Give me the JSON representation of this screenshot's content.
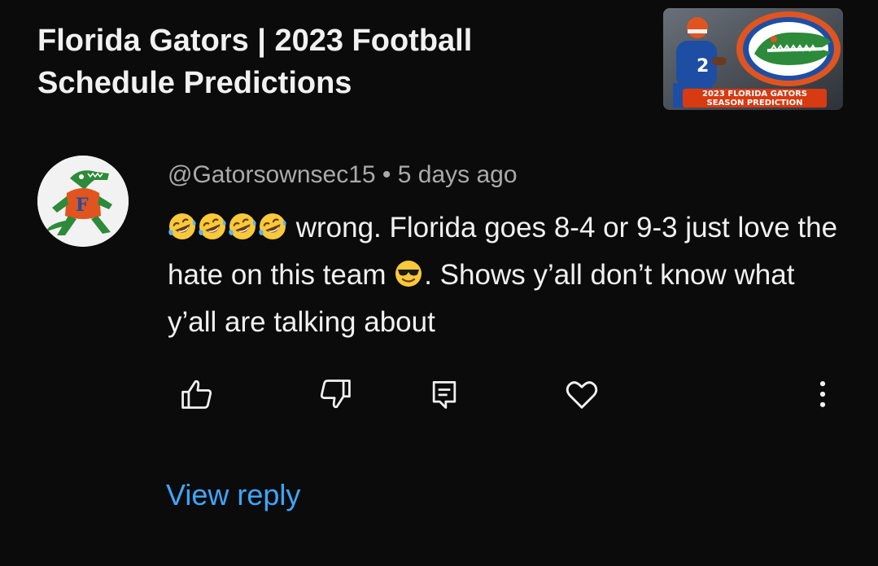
{
  "video": {
    "title": "Florida Gators | 2023 Football Schedule Predictions",
    "thumbnail": {
      "caption_line1": "2023 FLORIDA GATORS",
      "caption_line2": "SEASON PREDICTION"
    }
  },
  "comment": {
    "author": "@Gatorsownsec15",
    "separator": " • ",
    "time": "5 days ago",
    "text_part1": " wrong. Florida goes 8-4 or 9-3 just love the hate on this team ",
    "text_part2": ". Shows y’all don’t know what y’all are talking about",
    "leading_emoji": [
      "rolling-on-floor-laughing",
      "rolling-on-floor-laughing",
      "rolling-on-floor-laughing",
      "rolling-on-floor-laughing"
    ],
    "inline_emoji": "smiling-face-with-sunglasses"
  },
  "actions": {
    "icons": [
      "like-icon",
      "dislike-icon",
      "reply-icon",
      "heart-icon",
      "more-vert-icon"
    ]
  },
  "view_reply_label": "View reply",
  "colors": {
    "background": "#0b0b0b",
    "primary_text": "#f1f1f1",
    "secondary_text": "#aaaaaa",
    "link": "#3ea6ff",
    "gator_orange": "#e0551f",
    "gator_blue": "#1e4ea3",
    "gator_green": "#2d8a3a"
  }
}
